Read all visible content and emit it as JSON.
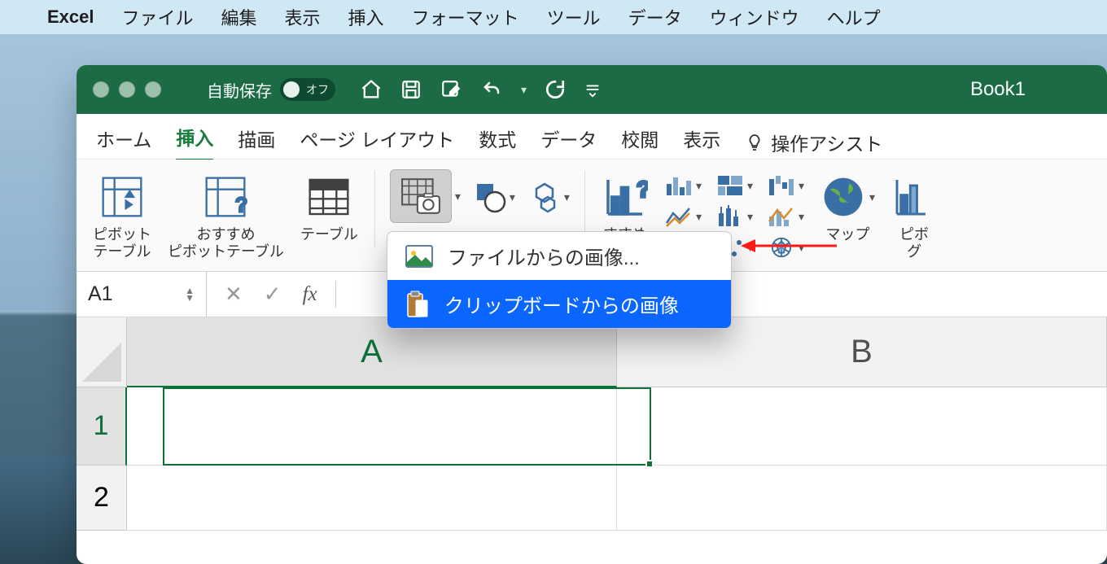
{
  "mac_menu": {
    "app": "Excel",
    "items": [
      "ファイル",
      "編集",
      "表示",
      "挿入",
      "フォーマット",
      "ツール",
      "データ",
      "ウィンドウ",
      "ヘルプ"
    ]
  },
  "window": {
    "title": "Book1",
    "autosave_label": "自動保存",
    "autosave_state": "オフ"
  },
  "ribbon_tabs": [
    "ホーム",
    "挿入",
    "描画",
    "ページ レイアウト",
    "数式",
    "データ",
    "校閲",
    "表示"
  ],
  "assist_label": "操作アシスト",
  "ribbon": {
    "pivot": "ピボット\nテーブル",
    "recommend_pivot": "おすすめ\nピボットテーブル",
    "table": "テーブル",
    "recommend_chart": "すすめ\nグラフ",
    "map": "マップ",
    "pivot_chart": "ピボ\nグ"
  },
  "img_menu": {
    "from_file": "ファイルからの画像...",
    "from_clipboard": "クリップボードからの画像"
  },
  "formula_bar": {
    "cell_ref": "A1",
    "fx": "fx"
  },
  "columns": [
    "A",
    "B"
  ],
  "rows": [
    "1",
    "2"
  ]
}
